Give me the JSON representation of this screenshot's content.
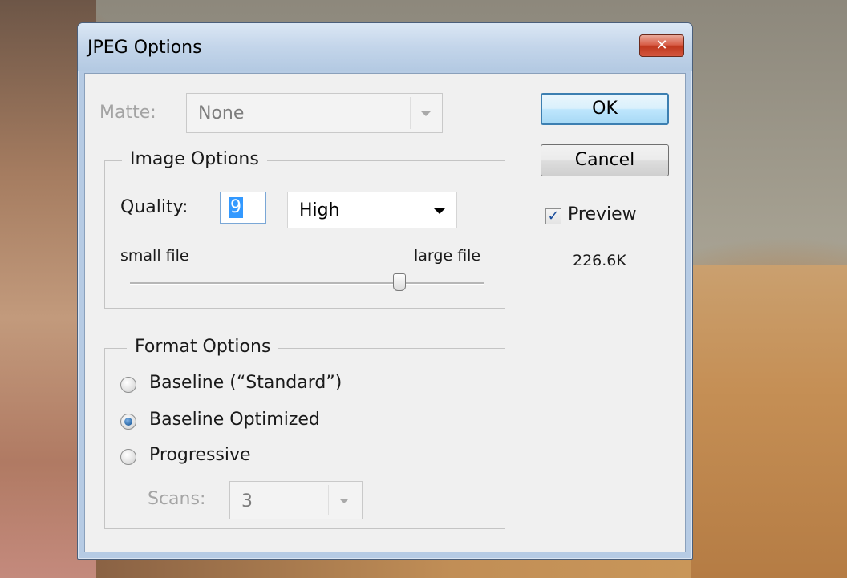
{
  "window": {
    "title": "JPEG Options",
    "close_glyph": "✕"
  },
  "matte": {
    "label": "Matte:",
    "value": "None"
  },
  "image_options": {
    "title": "Image Options",
    "quality_label": "Quality:",
    "quality_value": "9",
    "quality_preset": "High",
    "slider_min_label": "small file",
    "slider_max_label": "large file",
    "slider_level_fraction": 0.75
  },
  "format_options": {
    "title": "Format Options",
    "options": [
      {
        "label": "Baseline (“Standard”)",
        "checked": false
      },
      {
        "label": "Baseline Optimized",
        "checked": true
      },
      {
        "label": "Progressive",
        "checked": false
      }
    ],
    "scans_label": "Scans:",
    "scans_value": "3"
  },
  "buttons": {
    "ok": "OK",
    "cancel": "Cancel"
  },
  "preview": {
    "label": "Preview",
    "checked": true,
    "check_glyph": "✓",
    "file_size": "226.6K"
  }
}
